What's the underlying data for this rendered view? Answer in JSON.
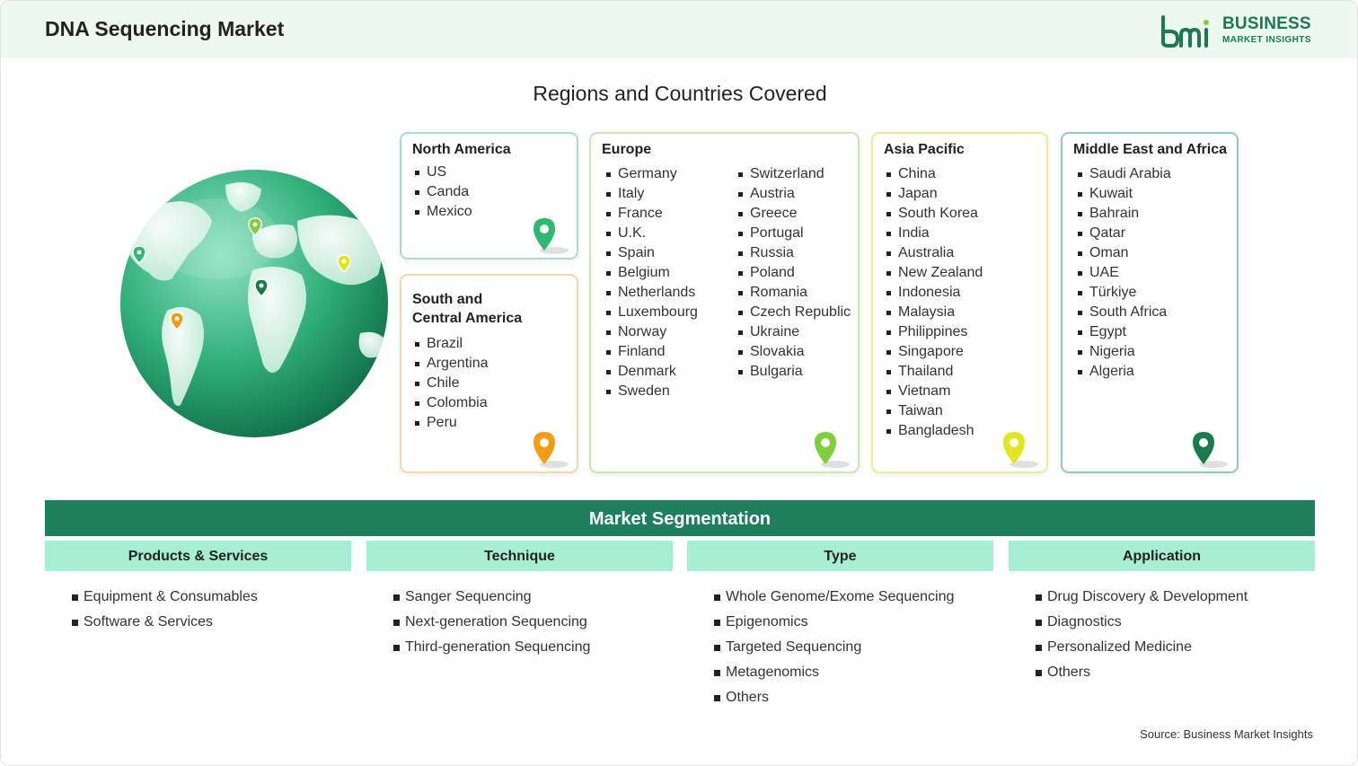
{
  "header": {
    "title": "DNA Sequencing Market",
    "logo_line1": "BUSINESS",
    "logo_line2": "MARKET INSIGHTS"
  },
  "regions_title": "Regions and Countries Covered",
  "regions": {
    "north_america": {
      "title": "North America",
      "items": [
        "US",
        "Canda",
        "Mexico"
      ],
      "pin_color": "#2eb872"
    },
    "south_central_america": {
      "title_line1": "South and",
      "title_line2": "Central America",
      "items": [
        "Brazil",
        "Argentina",
        "Chile",
        "Colombia",
        "Peru"
      ],
      "pin_color": "#f39c12"
    },
    "europe": {
      "title": "Europe",
      "col1": [
        "Germany",
        "Italy",
        "France",
        "U.K.",
        "Spain",
        "Belgium",
        "Netherlands",
        "Luxembourg",
        "Norway",
        "Finland",
        "Denmark",
        "Sweden"
      ],
      "col2": [
        "Switzerland",
        "Austria",
        "Greece",
        "Portugal",
        "Russia",
        "Poland",
        "Romania",
        "Czech Republic",
        "Ukraine",
        "Slovakia",
        "Bulgaria"
      ],
      "pin_color": "#7fcf3a"
    },
    "asia_pacific": {
      "title": "Asia Pacific",
      "items": [
        "China",
        "Japan",
        "South Korea",
        "India",
        "Australia",
        "New Zealand",
        "Indonesia",
        "Malaysia",
        "Philippines",
        "Singapore",
        "Thailand",
        "Vietnam",
        "Taiwan",
        "Bangladesh"
      ],
      "pin_color": "#e5e51f"
    },
    "middle_east_africa": {
      "title": "Middle East and Africa",
      "items": [
        "Saudi Arabia",
        "Kuwait",
        "Bahrain",
        "Qatar",
        "Oman",
        "UAE",
        "Türkiye",
        "South Africa",
        "Egypt",
        "Nigeria",
        "Algeria"
      ],
      "pin_color": "#1a7a4a"
    }
  },
  "segmentation": {
    "title": "Market Segmentation",
    "columns": [
      {
        "heading": "Products & Services",
        "items": [
          "Equipment & Consumables",
          "Software & Services"
        ]
      },
      {
        "heading": "Technique",
        "items": [
          "Sanger Sequencing",
          "Next-generation Sequencing",
          "Third-generation Sequencing"
        ]
      },
      {
        "heading": "Type",
        "items": [
          "Whole Genome/Exome Sequencing",
          "Epigenomics",
          "Targeted Sequencing",
          "Metagenomics",
          "Others"
        ]
      },
      {
        "heading": "Application",
        "items": [
          "Drug Discovery & Development",
          "Diagnostics",
          "Personalized Medicine",
          "Others"
        ]
      }
    ]
  },
  "source": "Source: Business Market Insights",
  "colors": {
    "brand_green": "#1d7f5c",
    "segment_header": "#a6efd5",
    "header_bg": "#eef8f3"
  }
}
